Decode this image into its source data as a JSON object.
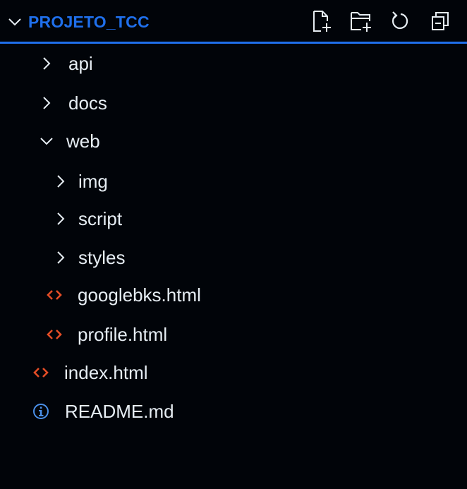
{
  "header": {
    "title": "PROJETO_TCC",
    "actions": [
      {
        "name": "new-file",
        "icon": "new-file-icon"
      },
      {
        "name": "new-folder",
        "icon": "new-folder-icon"
      },
      {
        "name": "refresh",
        "icon": "refresh-icon"
      },
      {
        "name": "collapse-all",
        "icon": "collapse-all-icon"
      }
    ]
  },
  "tree": {
    "api": {
      "label": "api",
      "state": "collapsed"
    },
    "docs": {
      "label": "docs",
      "state": "collapsed"
    },
    "web": {
      "label": "web",
      "state": "expanded"
    },
    "img": {
      "label": "img",
      "state": "collapsed"
    },
    "script": {
      "label": "script",
      "state": "collapsed"
    },
    "styles": {
      "label": "styles",
      "state": "collapsed"
    },
    "googlebks": {
      "label": "googlebks.html",
      "icon": "html-file-icon"
    },
    "profile": {
      "label": "profile.html",
      "icon": "html-file-icon"
    },
    "index": {
      "label": "index.html",
      "icon": "html-file-icon"
    },
    "readme": {
      "label": "README.md",
      "icon": "info-icon"
    }
  },
  "colors": {
    "background": "#010409",
    "accent": "#1f6feb",
    "text": "#e6edf3",
    "html_icon": "#e44d26",
    "info_icon": "#4a8fe7"
  }
}
